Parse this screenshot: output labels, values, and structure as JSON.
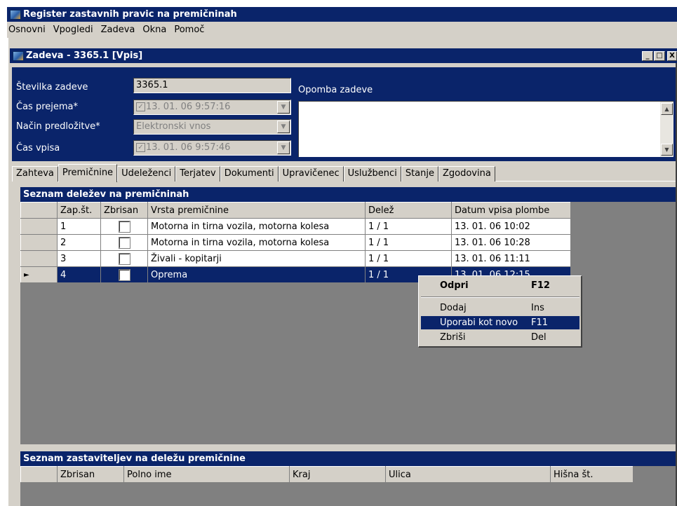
{
  "app": {
    "title": "Register zastavnih pravic na premičninah",
    "menu": [
      "Osnovni",
      "Vpogledi",
      "Zadeva",
      "Okna",
      "Pomoč"
    ]
  },
  "window": {
    "title": "Zadeva - 3365.1 [Vpis]",
    "minimize_glyph": "_",
    "maximize_glyph": "□",
    "close_glyph": "X"
  },
  "form": {
    "case_number_label": "Številka zadeve",
    "case_number": "3365.1",
    "received_label": "Čas prejema*",
    "received_value": "13. 01. 06  9:57:16",
    "submission_label": "Način predložitve*",
    "submission_value": "Elektronski vnos",
    "entry_label": "Čas vpisa",
    "entry_value": "13. 01. 06  9:57:46",
    "note_label": "Opomba zadeve",
    "note_value": ""
  },
  "tabs": [
    {
      "label": "Zahteva",
      "active": false
    },
    {
      "label": "Premičnine",
      "active": true
    },
    {
      "label": "Udeleženci",
      "active": false
    },
    {
      "label": "Terjatev",
      "active": false
    },
    {
      "label": "Dokumenti",
      "active": false
    },
    {
      "label": "Upravičenec",
      "active": false
    },
    {
      "label": "Uslužbenci",
      "active": false
    },
    {
      "label": "Stanje",
      "active": false
    },
    {
      "label": "Zgodovina",
      "active": false
    }
  ],
  "shares_grid": {
    "title": "Seznam deležev na premičninah",
    "columns": [
      "Zap.št.",
      "Zbrisan",
      "Vrsta premičnine",
      "Delež",
      "Datum vpisa plombe"
    ],
    "rows": [
      {
        "no": "1",
        "deleted": false,
        "type": "Motorna in tirna vozila, motorna kolesa",
        "share": "1 / 1",
        "date": "13. 01. 06 10:02",
        "selected": false
      },
      {
        "no": "2",
        "deleted": false,
        "type": "Motorna in tirna vozila, motorna kolesa",
        "share": "1 / 1",
        "date": "13. 01. 06 10:28",
        "selected": false
      },
      {
        "no": "3",
        "deleted": false,
        "type": "Živali - kopitarji",
        "share": "1 / 1",
        "date": "13. 01. 06 11:11",
        "selected": false
      },
      {
        "no": "4",
        "deleted": false,
        "type": "Oprema",
        "share": "1 / 1",
        "date": "13. 01. 06 12:15",
        "selected": true
      }
    ],
    "current_row_glyph": "►"
  },
  "context_menu": {
    "items": [
      {
        "label": "Odpri",
        "key": "F12",
        "bold": true,
        "highlighted": false
      },
      {
        "label": "Dodaj",
        "key": "Ins",
        "bold": false,
        "highlighted": false
      },
      {
        "label": "Uporabi kot novo",
        "key": "F11",
        "bold": false,
        "highlighted": true
      },
      {
        "label": "Zbriši",
        "key": "Del",
        "bold": false,
        "highlighted": false
      }
    ]
  },
  "pledgors_grid": {
    "title": "Seznam zastaviteljev na deležu premičnine",
    "columns": [
      "Zbrisan",
      "Polno ime",
      "Kraj",
      "Ulica",
      "Hišna št."
    ]
  },
  "colors": {
    "title_bar": "#0a246a",
    "face": "#d4d0c8",
    "grid_background": "#808080",
    "selection": "#0a246a"
  }
}
